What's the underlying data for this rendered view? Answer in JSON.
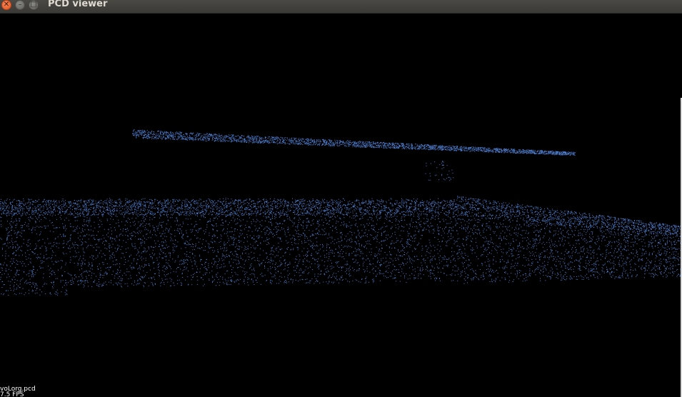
{
  "window": {
    "title": "PCD viewer",
    "close_glyph": "✕",
    "minimize_glyph": "–",
    "maximize_glyph": "□"
  },
  "viewer": {
    "filename": "voLorg.pcd",
    "fps_text": "7.5 FPS",
    "background_color": "#000000",
    "point_color": "#4f7fd0"
  }
}
